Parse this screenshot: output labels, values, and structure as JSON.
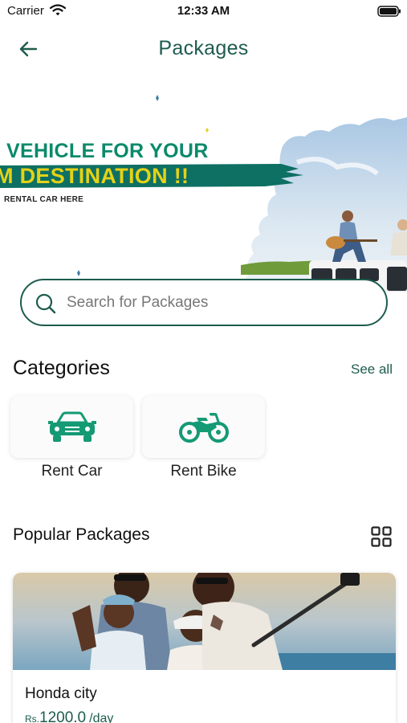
{
  "status_bar": {
    "carrier": "Carrier",
    "time": "12:33 AM"
  },
  "header": {
    "title": "Packages",
    "back_icon": "arrow-left-icon"
  },
  "banner": {
    "headline_line1": "VEHICLE FOR YOUR",
    "headline_line2": "M DESTINATION !!",
    "subtext": "RENTAL CAR HERE"
  },
  "search": {
    "placeholder": "Search for Packages",
    "value": "",
    "icon": "search-icon"
  },
  "categories": {
    "title": "Categories",
    "see_all_label": "See all",
    "items": [
      {
        "label": "Rent Car",
        "icon": "car-icon"
      },
      {
        "label": "Rent Bike",
        "icon": "motorbike-icon"
      }
    ]
  },
  "popular": {
    "title": "Popular Packages",
    "grid_icon": "grid-view-icon",
    "packages": [
      {
        "name": "Honda city",
        "currency": "Rs.",
        "price": "1200.0",
        "unit": "/day"
      }
    ]
  },
  "colors": {
    "brand": "#1d5c4e",
    "accent_green": "#0b8a6b",
    "accent_yellow": "#e5d216",
    "category_icon": "#149a74"
  }
}
